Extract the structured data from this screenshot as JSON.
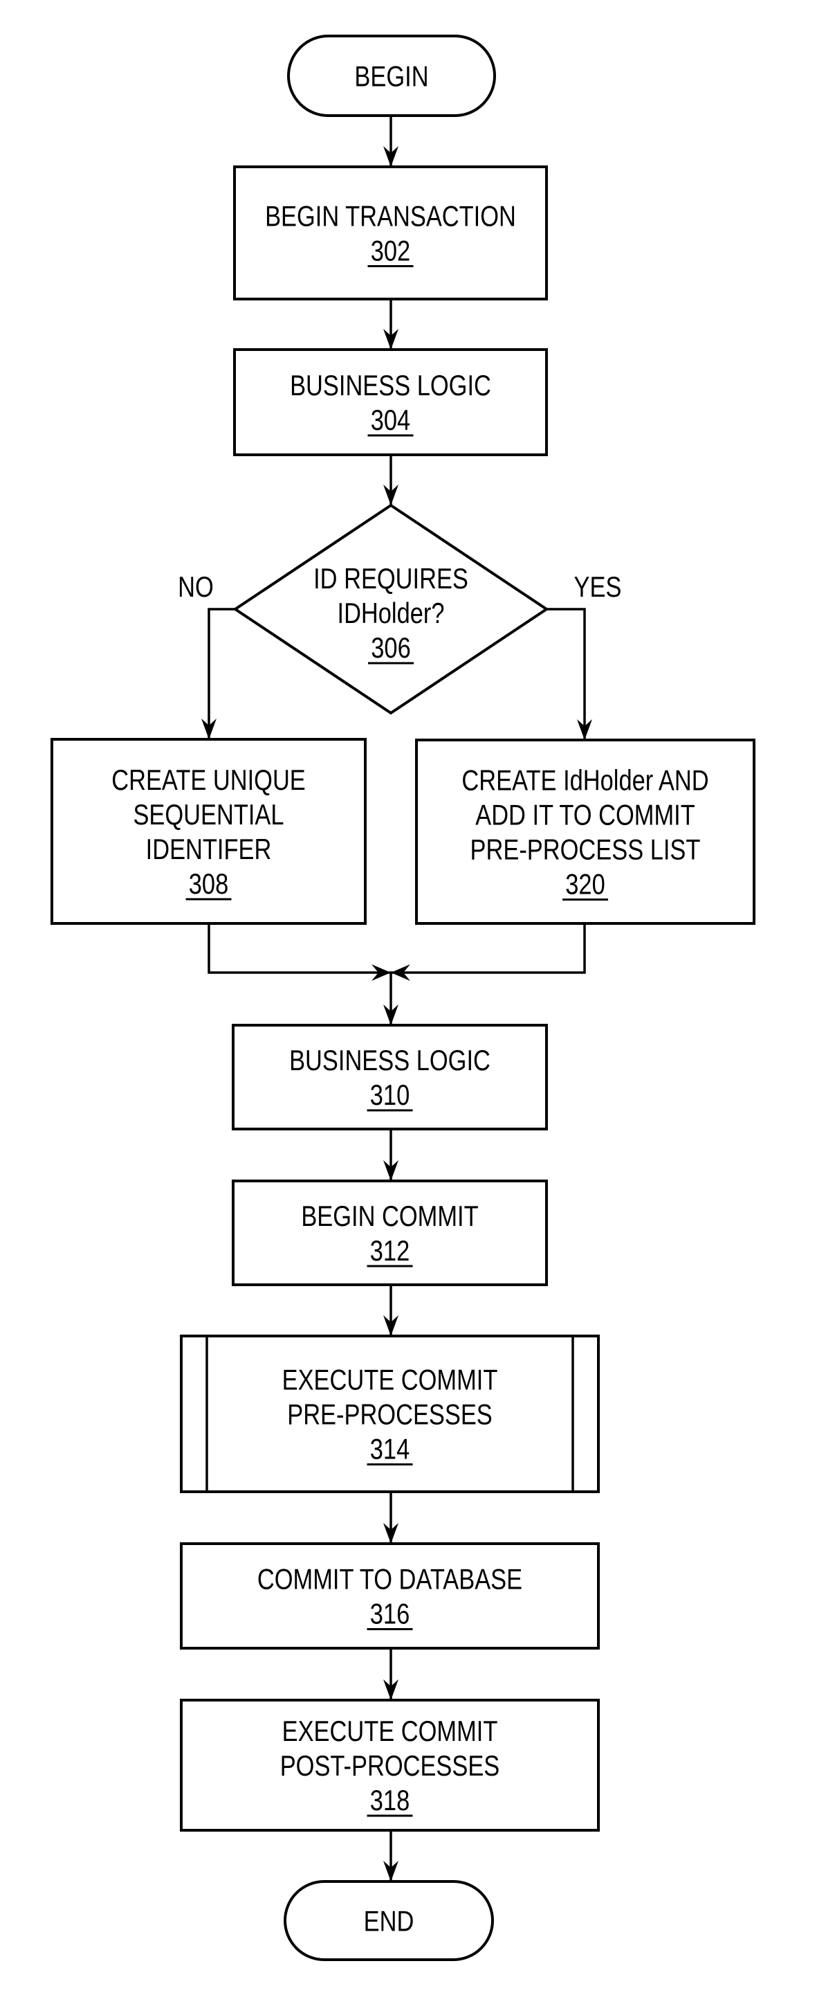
{
  "diagram": {
    "type": "flowchart",
    "nodes": [
      {
        "id": "begin",
        "kind": "terminal",
        "lines": [
          "BEGIN"
        ],
        "ref": ""
      },
      {
        "id": "302",
        "kind": "process",
        "lines": [
          "BEGIN TRANSACTION"
        ],
        "ref": "302"
      },
      {
        "id": "304",
        "kind": "process",
        "lines": [
          "BUSINESS LOGIC"
        ],
        "ref": "304"
      },
      {
        "id": "306",
        "kind": "decision",
        "lines": [
          "ID REQUIRES",
          "IDHolder?"
        ],
        "ref": "306"
      },
      {
        "id": "308",
        "kind": "process",
        "lines": [
          "CREATE UNIQUE",
          "SEQUENTIAL",
          "IDENTIFER"
        ],
        "ref": "308"
      },
      {
        "id": "320",
        "kind": "process",
        "lines": [
          "CREATE IdHolder AND",
          "ADD IT TO COMMIT",
          "PRE-PROCESS LIST"
        ],
        "ref": "320"
      },
      {
        "id": "310",
        "kind": "process",
        "lines": [
          "BUSINESS LOGIC"
        ],
        "ref": "310"
      },
      {
        "id": "312",
        "kind": "process",
        "lines": [
          "BEGIN COMMIT"
        ],
        "ref": "312"
      },
      {
        "id": "314",
        "kind": "predefined-process",
        "lines": [
          "EXECUTE COMMIT",
          "PRE-PROCESSES"
        ],
        "ref": "314"
      },
      {
        "id": "316",
        "kind": "process",
        "lines": [
          "COMMIT TO DATABASE"
        ],
        "ref": "316"
      },
      {
        "id": "318",
        "kind": "process",
        "lines": [
          "EXECUTE COMMIT",
          "POST-PROCESSES"
        ],
        "ref": "318"
      },
      {
        "id": "end",
        "kind": "terminal",
        "lines": [
          "END"
        ],
        "ref": ""
      }
    ],
    "edges": [
      {
        "from": "begin",
        "to": "302",
        "label": ""
      },
      {
        "from": "302",
        "to": "304",
        "label": ""
      },
      {
        "from": "304",
        "to": "306",
        "label": ""
      },
      {
        "from": "306",
        "to": "308",
        "label": "NO"
      },
      {
        "from": "306",
        "to": "320",
        "label": "YES"
      },
      {
        "from": "308",
        "to": "310",
        "label": ""
      },
      {
        "from": "320",
        "to": "310",
        "label": ""
      },
      {
        "from": "310",
        "to": "312",
        "label": ""
      },
      {
        "from": "312",
        "to": "314",
        "label": ""
      },
      {
        "from": "314",
        "to": "316",
        "label": ""
      },
      {
        "from": "316",
        "to": "318",
        "label": ""
      },
      {
        "from": "318",
        "to": "end",
        "label": ""
      }
    ]
  }
}
